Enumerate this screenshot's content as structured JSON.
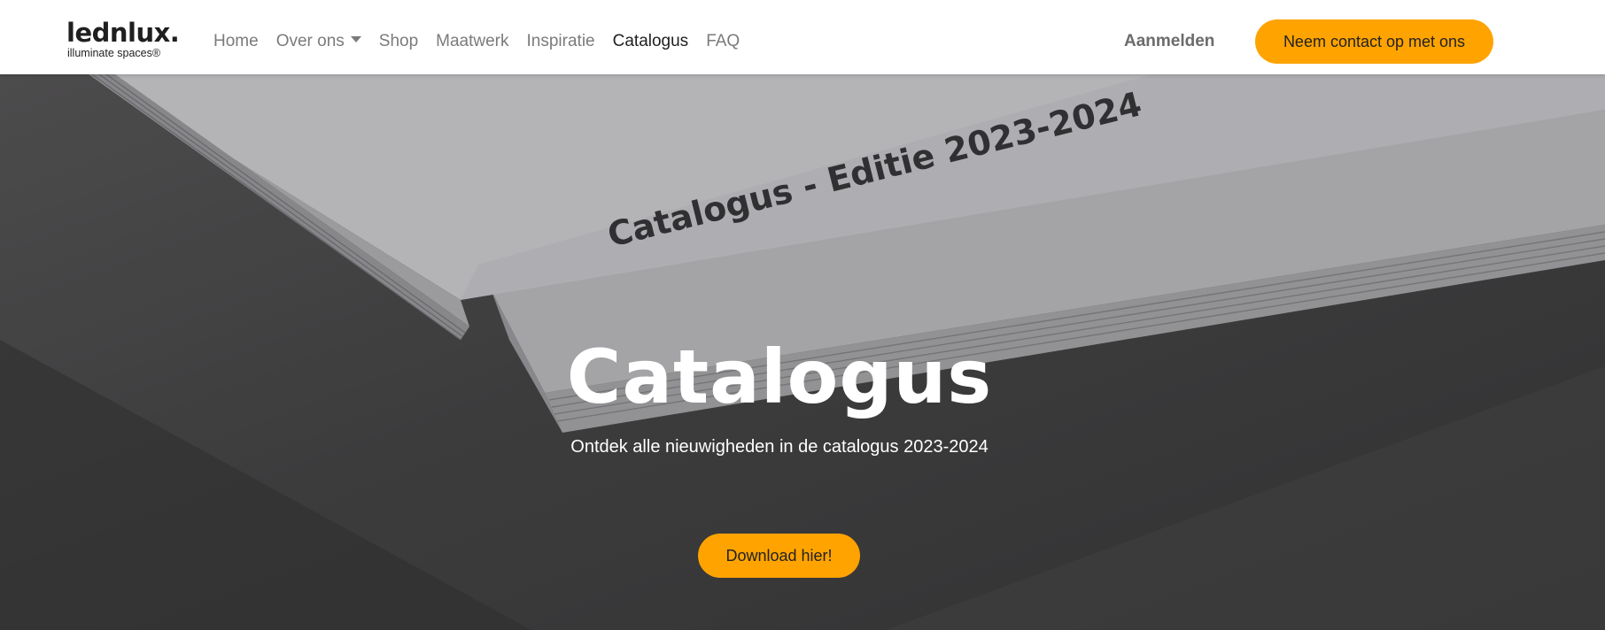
{
  "header": {
    "logo": {
      "word": "lednlux.",
      "tagline": "illuminate spaces®"
    },
    "nav": [
      {
        "label": "Home"
      },
      {
        "label": "Over ons"
      },
      {
        "label": "Shop"
      },
      {
        "label": "Maatwerk"
      },
      {
        "label": "Inspiratie"
      },
      {
        "label": "Catalogus"
      },
      {
        "label": "FAQ"
      }
    ],
    "signin_label": "Aanmelden",
    "contact_label": "Neem contact op met ons"
  },
  "hero": {
    "title": "Catalogus",
    "subtitle": "Ontdek alle nieuwigheden in de catalogus 2023-2024",
    "download_label": "Download hier!",
    "book_spine_text": "Catalogus - Editie 2023-2024"
  },
  "colors": {
    "accent": "#ffa300",
    "nav_text": "#7b7b7b",
    "nav_active": "#1f1f1f"
  },
  "icons": {
    "dropdown": "caret-down-icon"
  }
}
